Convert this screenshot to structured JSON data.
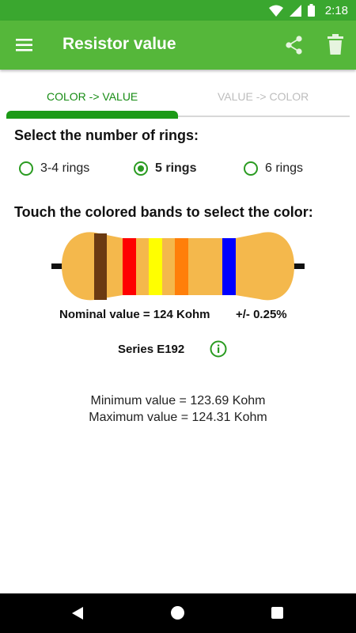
{
  "status": {
    "time": "2:18"
  },
  "appbar": {
    "title": "Resistor value"
  },
  "tabs": [
    {
      "label": "COLOR -> VALUE",
      "active": true
    },
    {
      "label": "VALUE -> COLOR",
      "active": false
    }
  ],
  "rings_section": {
    "title": "Select the number of rings:",
    "options": [
      {
        "label": "3-4 rings",
        "selected": false
      },
      {
        "label": "5 rings",
        "selected": true
      },
      {
        "label": "6 rings",
        "selected": false
      }
    ]
  },
  "bands_section": {
    "title": "Touch the colored bands to select the color:",
    "bands": [
      {
        "color_name": "brown",
        "hex": "#6b3a12"
      },
      {
        "color_name": "red",
        "hex": "#ff0000"
      },
      {
        "color_name": "yellow",
        "hex": "#ffff00"
      },
      {
        "color_name": "orange",
        "hex": "#ff7f0a"
      },
      {
        "color_name": "blue",
        "hex": "#0000ff"
      }
    ],
    "body_color": "#f4b84c"
  },
  "result": {
    "nominal": "Nominal value = 124 Kohm",
    "tolerance": "+/- 0.25%",
    "series": "Series E192",
    "minimum": "Minimum value = 123.69 Kohm",
    "maximum": "Maximum value = 124.31 Kohm"
  },
  "colors": {
    "status_bar": "#3aa72f",
    "app_bar": "#55b73a",
    "accent": "#1c9a17"
  }
}
